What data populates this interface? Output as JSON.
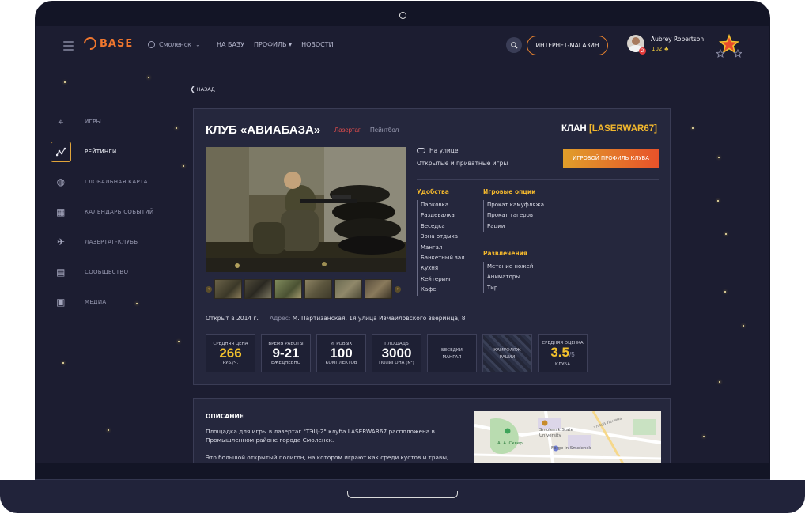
{
  "header": {
    "logo": "BASE",
    "city": "Смоленск",
    "nav": [
      "НА БАЗУ",
      "ПРОФИЛЬ ▾",
      "НОВОСТИ"
    ],
    "shop_label": "ИНТЕРНЕТ-МАГАЗИН",
    "user_name": "Aubrey Robertson",
    "user_points": "102 ♣",
    "notifications": "2"
  },
  "back_label": "НАЗАД",
  "sidebar": {
    "items": [
      {
        "label": "ИГРЫ",
        "icon": "crosshair-icon"
      },
      {
        "label": "РЕЙТИНГИ",
        "icon": "ratings-graph-icon"
      },
      {
        "label": "ГЛОБАЛЬНАЯ КАРТА",
        "icon": "globe-icon"
      },
      {
        "label": "КАЛЕНДАРЬ СОБЫТИЙ",
        "icon": "calendar-icon"
      },
      {
        "label": "ЛАЗЕРТАГ-КЛУБЫ",
        "icon": "rocket-icon"
      },
      {
        "label": "СООБЩЕСТВО",
        "icon": "chat-icon"
      },
      {
        "label": "МЕДИА",
        "icon": "image-icon"
      }
    ],
    "active_index": 1
  },
  "club": {
    "title": "КЛУБ «АВИАБАЗА»",
    "tag_laser": "Лазертаг",
    "tag_paint": "Пейнтбол",
    "clan_prefix": "КЛАН",
    "clan_name": "[LASERWAR67]",
    "weather": "На улице",
    "games": "Открытые и приватные игры",
    "profile_button": "ИГРОВОЙ ПРОФИЛЬ КЛУБА",
    "features": {
      "comfort_title": "Удобства",
      "comfort": [
        "Парковка",
        "Раздевалка",
        "Беседка",
        "Зона отдыха",
        "Мангал",
        "Банкетный зал",
        "Кухня",
        "Кейтеринг",
        "Кафе"
      ],
      "options_title": "Игровые опции",
      "options": [
        "Прокат камуфляжа",
        "Прокат тагеров",
        "Рации"
      ],
      "fun_title": "Развлечения",
      "fun": [
        "Метание ножей",
        "Аниматоры",
        "Тир"
      ]
    },
    "opened": "Открыт в 2014 г.",
    "address_label": "Адрес:",
    "address": "М. Партизанская, 1я улица Измайловского зверинца, 8",
    "stats": {
      "price": {
        "title": "СРЕДНЯЯ ЦЕНА",
        "value": "266",
        "unit": "РУБ./Ч."
      },
      "hours": {
        "title": "ВРЕМЯ РАБОТЫ",
        "value": "9-21",
        "unit": "ЕЖЕДНЕВНО"
      },
      "kits": {
        "title": "ИГРОВЫХ",
        "value": "100",
        "unit": "КОМПЛЕКТОВ"
      },
      "area": {
        "title": "ПЛОЩАДЬ",
        "value": "3000",
        "unit": "ПОЛИГОНА (м²)"
      },
      "gazebo": {
        "l1": "БЕСЕДКИ",
        "l2": "МАНГАЛ"
      },
      "camo": {
        "l1": "КАМУФЛЯЖ",
        "l2": "РАЦИИ"
      },
      "rating": {
        "title": "СРЕДНЯЯ ОЦЕНКА",
        "value": "3.5",
        "max": "/5",
        "unit": "КЛУБА"
      }
    }
  },
  "description": {
    "title": "ОПИСАНИЕ",
    "p1": "Площадка для игры в лазертаг \"ТЭЦ-2\" клуба LASERWAR67 расположена в Промышленном районе города Смоленск.",
    "p2": "Это большой открытый полигон, на котором играют как среди кустов и травы,"
  },
  "map": {
    "label_university": "Smolensk State University",
    "label_garden": "А. А. Сквер",
    "label_forge": "Forge in Smolensk",
    "label_street": "улица Ленина"
  },
  "colors": {
    "accent": "#f2b72d",
    "brand": "#f0772e",
    "background": "#1c1d31",
    "panel": "#25273d"
  }
}
